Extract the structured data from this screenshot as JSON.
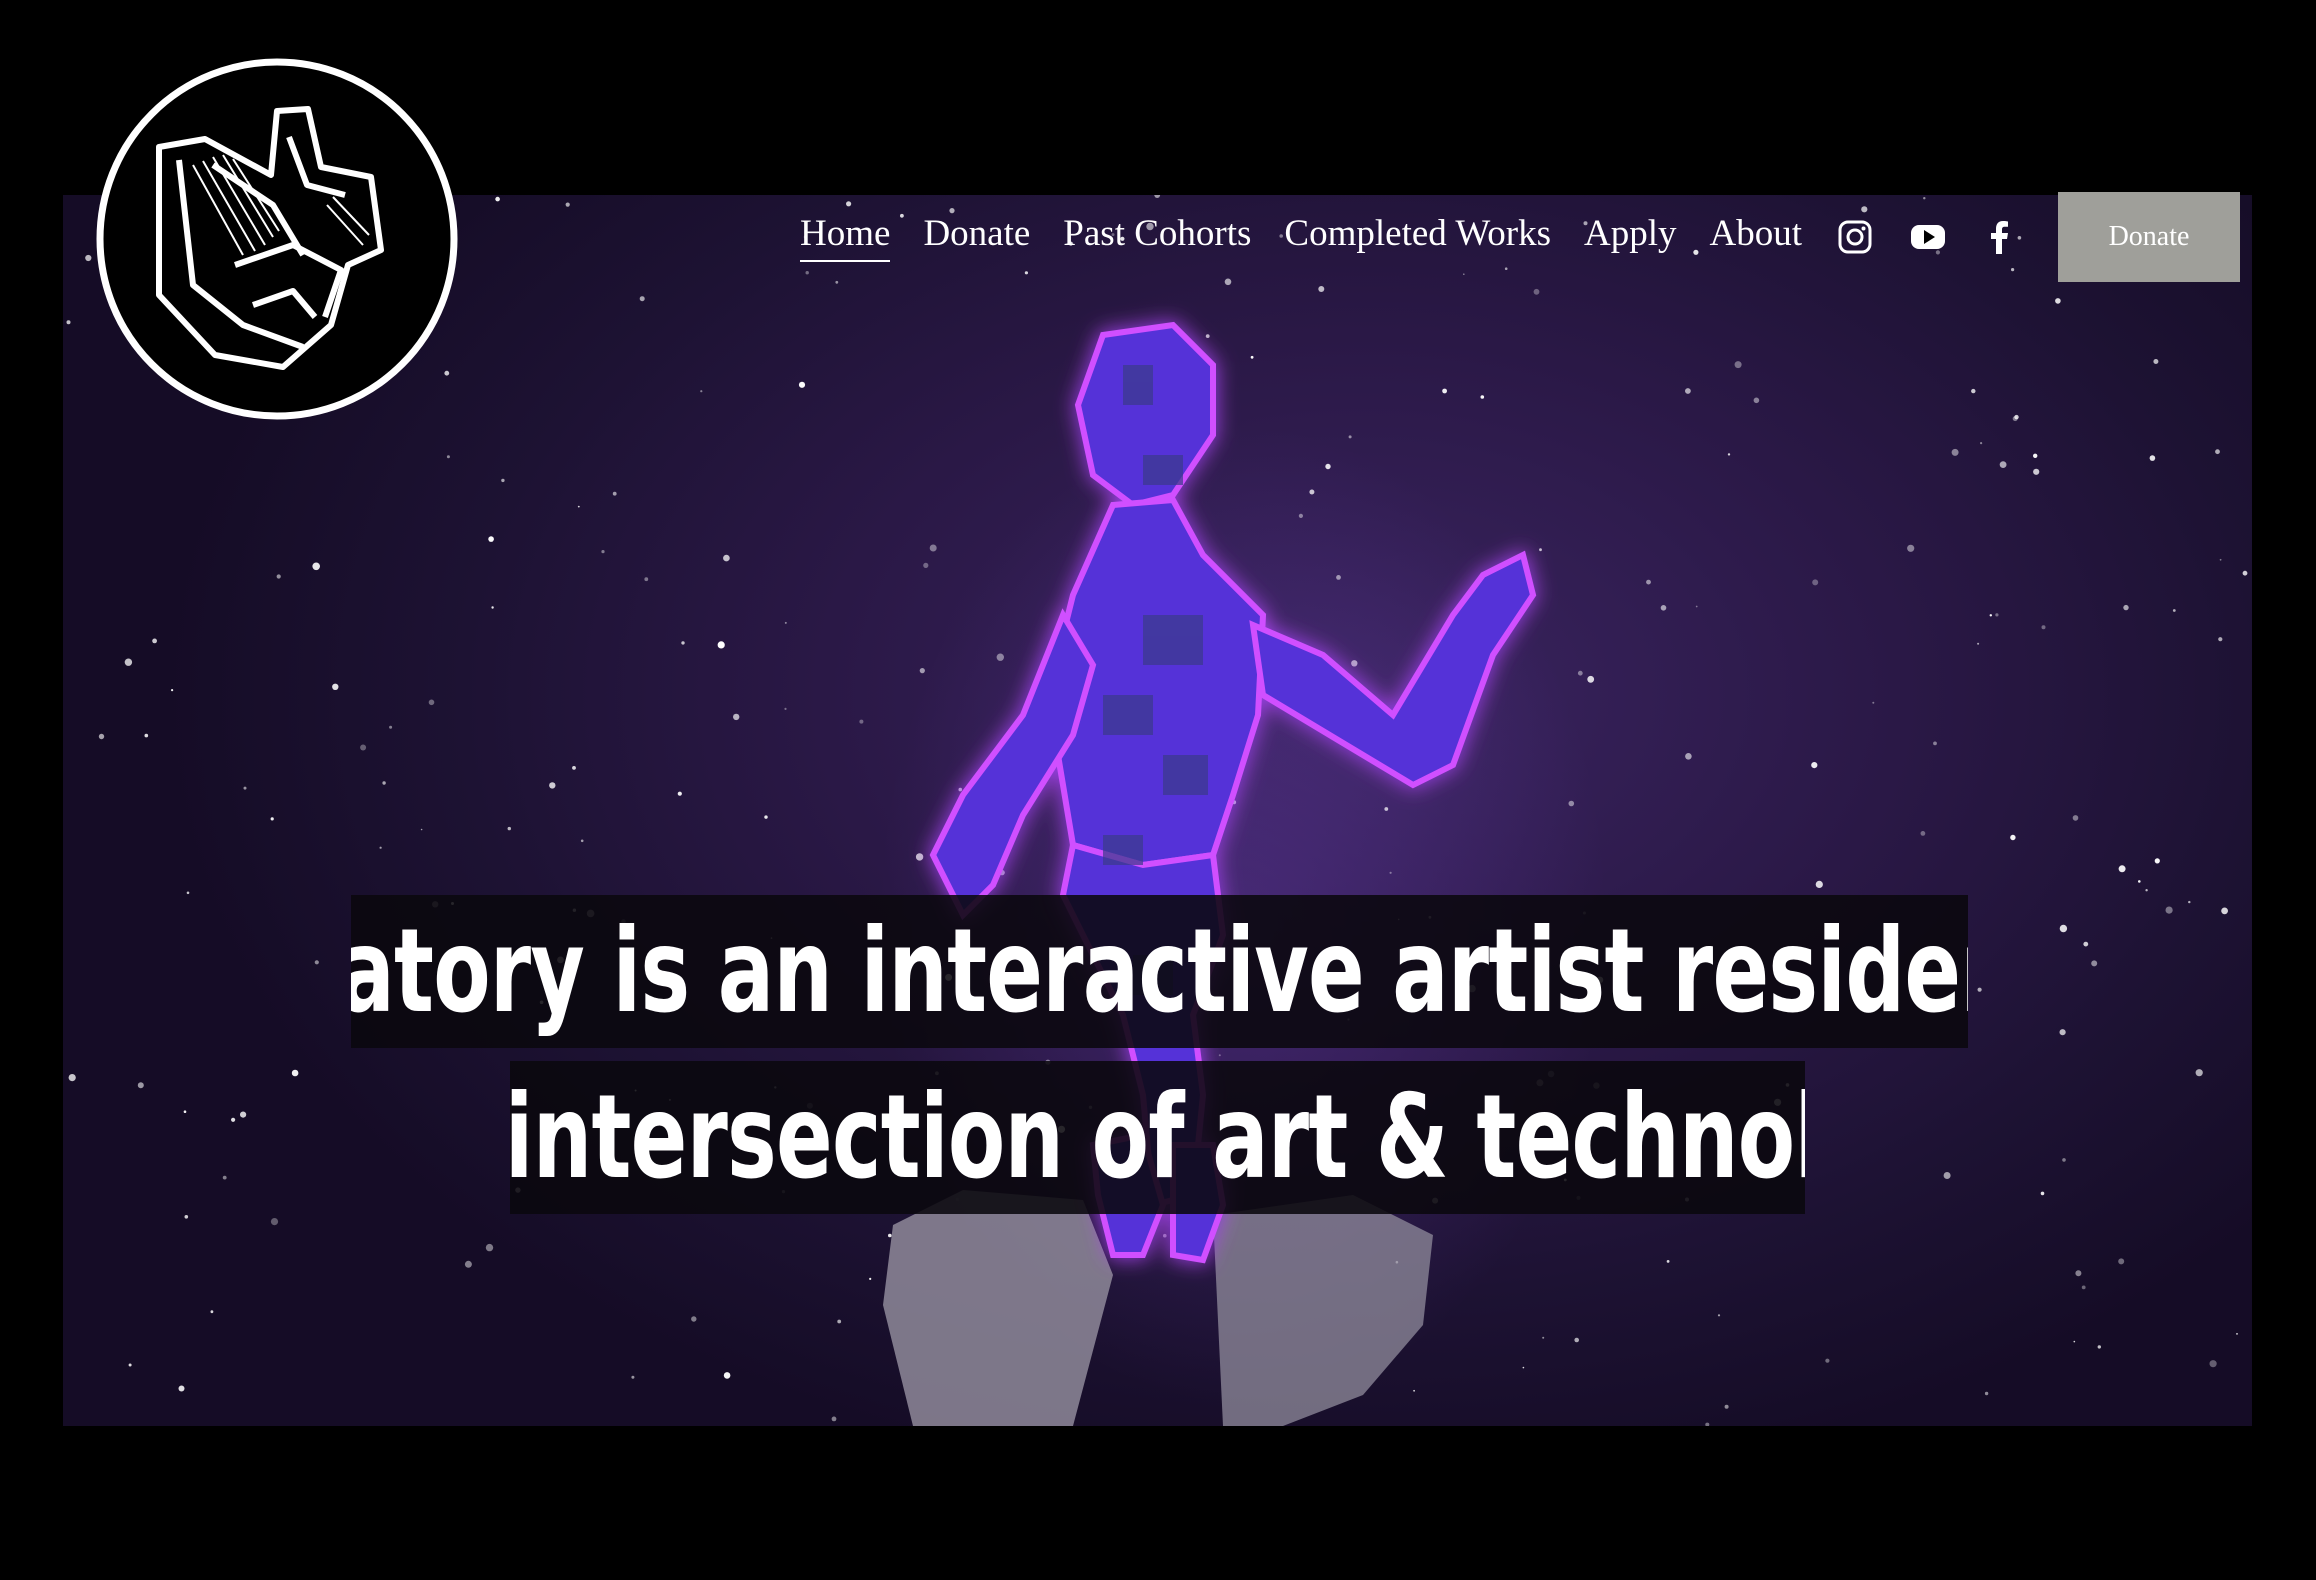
{
  "logo": {
    "alt": "Laboratory logo"
  },
  "nav": {
    "items": [
      {
        "label": "Home",
        "active": true
      },
      {
        "label": "Donate",
        "active": false
      },
      {
        "label": "Past Cohorts",
        "active": false
      },
      {
        "label": "Completed Works",
        "active": false
      },
      {
        "label": "Apply",
        "active": false
      },
      {
        "label": "About",
        "active": false
      }
    ],
    "social": [
      "instagram-icon",
      "youtube-icon",
      "facebook-icon"
    ],
    "donate_button": "Donate"
  },
  "hero": {
    "headline_line1": "Laboratory is an interactive artist residency at",
    "headline_line2": "the intersection of art & technology"
  },
  "colors": {
    "background": "#000000",
    "button": "#9f9f9a",
    "figure_glow": "#a040ff"
  }
}
